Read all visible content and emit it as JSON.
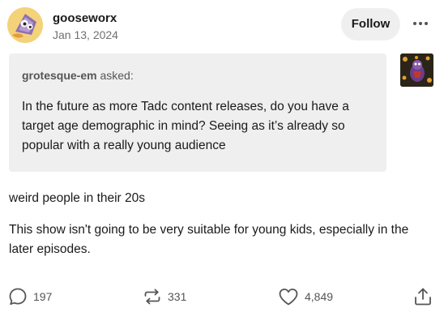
{
  "post": {
    "author": "gooseworx",
    "date": "Jan 13, 2024",
    "follow_label": "Follow",
    "more_icon": "more-dots-icon",
    "avatar_icon": "author-avatar"
  },
  "ask": {
    "asker": "grotesque-em",
    "asked_label": "asked:",
    "question": "In the future as more Tadc content releases, do you have a target age demographic in mind? Seeing as it’s already so popular with a really young audience",
    "asker_avatar_icon": "asker-avatar"
  },
  "answer": {
    "paragraphs": [
      "weird people in their 20s",
      "This show isn't going to be very suitable for young kids, especially in the later episodes."
    ]
  },
  "footer": {
    "replies": "197",
    "reblogs": "331",
    "likes": "4,849",
    "reply_icon": "speech-bubble-icon",
    "reblog_icon": "reblog-icon",
    "like_icon": "heart-icon",
    "share_icon": "share-icon"
  },
  "colors": {
    "ask_background": "#efefef",
    "follow_background": "#efefef",
    "meta_text": "#707070",
    "body_text": "#1a1a1a"
  }
}
